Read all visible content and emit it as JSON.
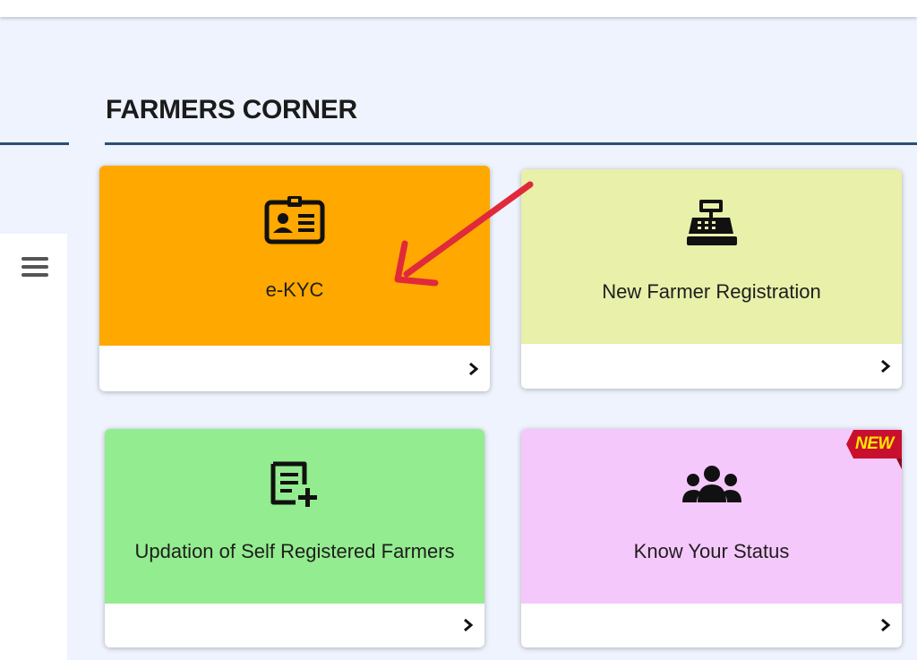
{
  "section": {
    "title": "FARMERS CORNER"
  },
  "colors": {
    "ekyc": "#ffa800",
    "new_registration": "#e8f0a9",
    "updation": "#93ec8f",
    "status": "#f5c8fb",
    "rule": "#2c4f73",
    "annotation_arrow": "#e0293b",
    "badge": "#c8102e"
  },
  "cards": [
    {
      "label": "e-KYC",
      "icon": "id-card-icon"
    },
    {
      "label": "New Farmer Registration",
      "icon": "cash-register-icon"
    },
    {
      "label": "Updation of Self Registered Farmers",
      "icon": "document-add-icon"
    },
    {
      "label": "Know Your Status",
      "icon": "users-group-icon"
    }
  ],
  "badge": {
    "text": "NEW"
  }
}
